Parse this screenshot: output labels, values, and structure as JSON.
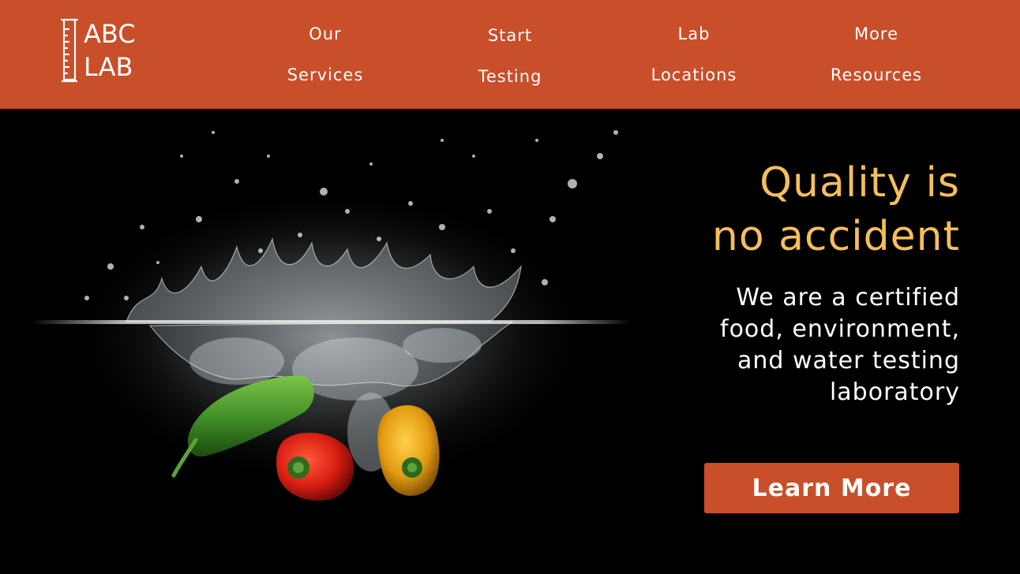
{
  "brand": {
    "logo_line1": "ABC",
    "logo_line2": "LAB",
    "logo_icon": "graduated-cylinder-icon"
  },
  "nav": {
    "items": [
      {
        "line1": "Our",
        "line2": "Services"
      },
      {
        "line1": "Start",
        "line2": "Testing"
      },
      {
        "line1": "Lab",
        "line2": "Locations"
      },
      {
        "line1": "More",
        "line2": "Resources"
      }
    ]
  },
  "hero": {
    "image": "peppers-splashing-in-water-image",
    "headline_line1": "Quality is",
    "headline_line2": "no accident",
    "sub_lines": [
      "We are a certified",
      "food, environment,",
      "and water testing",
      "laboratory"
    ],
    "cta_label": "Learn More"
  },
  "colors": {
    "accent": "#c94e2a",
    "headline": "#f7be5a",
    "background": "#000000",
    "text": "#ffffff"
  }
}
